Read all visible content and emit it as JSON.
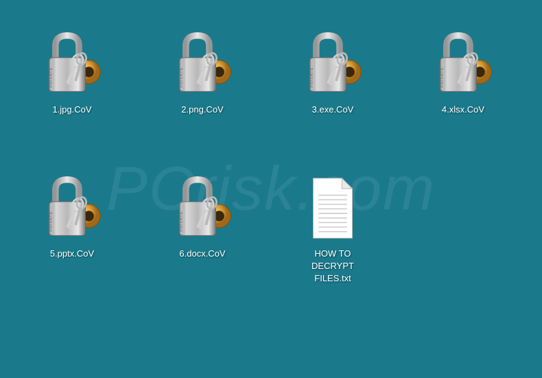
{
  "watermark": "PCrisk.com",
  "files": [
    {
      "name": "1.jpg.CoV",
      "icon": "padlock"
    },
    {
      "name": "2.png.CoV",
      "icon": "padlock"
    },
    {
      "name": "3.exe.CoV",
      "icon": "padlock"
    },
    {
      "name": "4.xlsx.CoV",
      "icon": "padlock"
    },
    {
      "name": "5.pptx.CoV",
      "icon": "padlock"
    },
    {
      "name": "6.docx.CoV",
      "icon": "padlock"
    },
    {
      "name": "HOW TO DECRYPT FILES.txt",
      "icon": "textfile"
    }
  ]
}
